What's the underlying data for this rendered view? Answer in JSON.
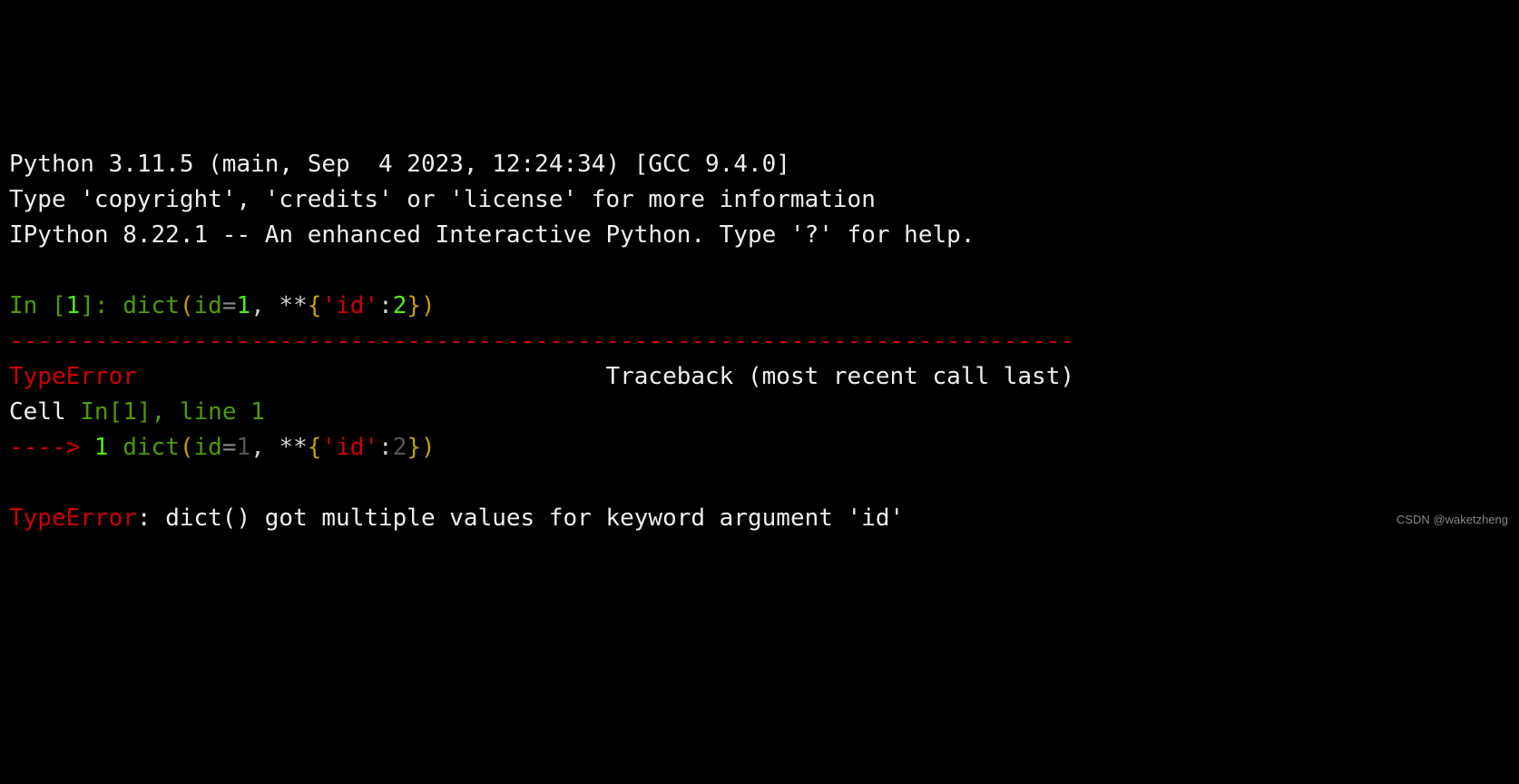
{
  "header": {
    "line1": "Python 3.11.5 (main, Sep  4 2023, 12:24:34) [GCC 9.4.0]",
    "line2": "Type 'copyright', 'credits' or 'license' for more information",
    "line3": "IPython 8.22.1 -- An enhanced Interactive Python. Type '?' for help."
  },
  "input": {
    "prompt_in": "In [",
    "index": "1",
    "prompt_close": "]: ",
    "code": {
      "fn": "dict",
      "open": "(",
      "kw_id": "id",
      "eq": "=",
      "val1": "1",
      "comma_sp": ", ",
      "star": "**",
      "lbrace": "{",
      "str_q1": "'",
      "str_id": "id",
      "str_q2": "'",
      "colon": ":",
      "val2": "2",
      "rbrace": "}",
      "close": ")"
    }
  },
  "tb": {
    "sep": "---------------------------------------------------------------------------",
    "err_name": "TypeError",
    "right": "Traceback (most recent call last)",
    "cell_pre": "Cell ",
    "cell_in": "In[1]",
    "cell_post": ", line 1",
    "arrow": "----> ",
    "lineno": "1",
    "sp": " ",
    "code": {
      "fn": "dict",
      "open": "(",
      "kw_id": "id",
      "eq": "=",
      "val1": "1",
      "comma_sp": ", ",
      "star": "**",
      "lbrace": "{",
      "str_q1": "'",
      "str_id": "id",
      "str_q2": "'",
      "colon": ":",
      "val2": "2",
      "rbrace": "}",
      "close": ")"
    }
  },
  "err": {
    "name": "TypeError",
    "msg": ": dict() got multiple values for keyword argument 'id'"
  },
  "watermark": "CSDN @waketzheng"
}
